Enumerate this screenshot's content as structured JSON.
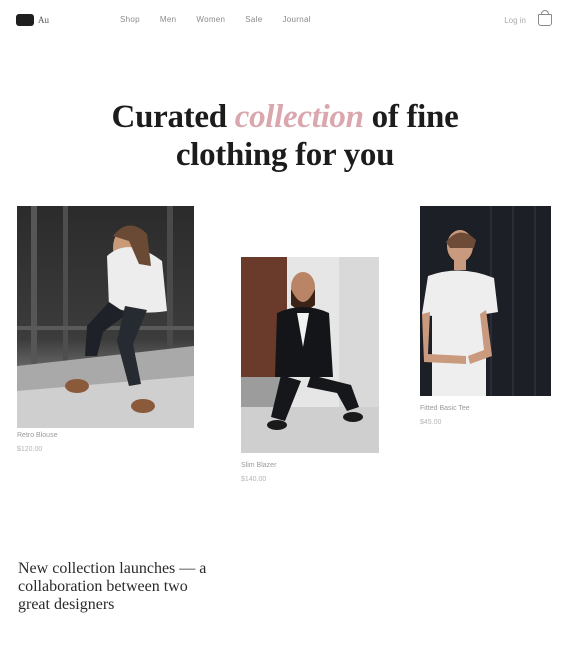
{
  "header": {
    "logo_text": "Au",
    "nav": [
      "Shop",
      "Men",
      "Women",
      "Sale",
      "Journal"
    ],
    "login_label": "Log in"
  },
  "hero": {
    "line1_before": "Curated ",
    "line1_accent": "collection",
    "line1_after": " of fine",
    "line2": "clothing for you"
  },
  "products": [
    {
      "name": "Retro Blouse",
      "price": "$120.00"
    },
    {
      "name": "Slim Blazer",
      "price": "$140.00"
    },
    {
      "name": "Fitted Basic Tee",
      "price": "$45.00"
    }
  ],
  "promo": {
    "text": "New collection launches — a collaboration between two great designers"
  },
  "colors": {
    "accent": "#d9a7ad",
    "text": "#1c1c1c",
    "muted": "#9a9a9a"
  },
  "icons": {
    "logo": "logo-mark",
    "cart": "shopping-bag-icon"
  }
}
